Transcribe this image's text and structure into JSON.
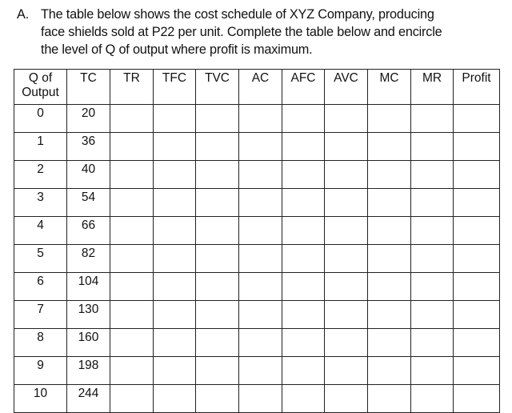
{
  "question": {
    "label": "A.",
    "lines": [
      "The table below shows the cost schedule of XYZ Company, producing",
      "face shields sold at P22 per unit.  Complete the table below and encircle",
      "the level of Q of output where profit is maximum."
    ]
  },
  "table": {
    "headers": [
      {
        "line1": "Q of",
        "line2": "Output"
      },
      {
        "line1": "TC",
        "line2": ""
      },
      {
        "line1": "TR",
        "line2": ""
      },
      {
        "line1": "TFC",
        "line2": ""
      },
      {
        "line1": "TVC",
        "line2": ""
      },
      {
        "line1": "AC",
        "line2": ""
      },
      {
        "line1": "AFC",
        "line2": ""
      },
      {
        "line1": "AVC",
        "line2": ""
      },
      {
        "line1": "MC",
        "line2": ""
      },
      {
        "line1": "MR",
        "line2": ""
      },
      {
        "line1": "Profit",
        "line2": ""
      }
    ],
    "rows": [
      {
        "q": "0",
        "tc": "20"
      },
      {
        "q": "1",
        "tc": "36"
      },
      {
        "q": "2",
        "tc": "40"
      },
      {
        "q": "3",
        "tc": "54"
      },
      {
        "q": "4",
        "tc": "66"
      },
      {
        "q": "5",
        "tc": "82"
      },
      {
        "q": "6",
        "tc": "104"
      },
      {
        "q": "7",
        "tc": "130"
      },
      {
        "q": "8",
        "tc": "160"
      },
      {
        "q": "9",
        "tc": "198"
      },
      {
        "q": "10",
        "tc": "244"
      }
    ]
  }
}
